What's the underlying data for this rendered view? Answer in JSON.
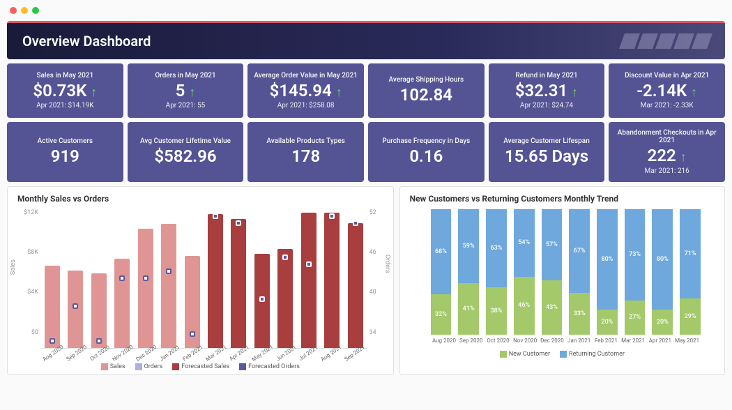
{
  "mac_dots": [
    "#ff5f57",
    "#febc2e",
    "#28c840"
  ],
  "header_title": "Overview Dashboard",
  "kpis_row1": [
    {
      "title": "Sales in May 2021",
      "value": "$0.73K",
      "arrow": true,
      "sub": "Apr 2021: $14.19K"
    },
    {
      "title": "Orders in May 2021",
      "value": "5",
      "arrow": true,
      "sub": "Apr 2021: 55"
    },
    {
      "title": "Average Order Value in May 2021",
      "value": "$145.94",
      "arrow": true,
      "sub": "Apr 2021: $258.08"
    },
    {
      "title": "Average Shipping Hours",
      "value": "102.84",
      "arrow": false,
      "sub": ""
    },
    {
      "title": "Refund in May 2021",
      "value": "$32.31",
      "arrow": true,
      "sub": "Apr 2021: $24.74"
    },
    {
      "title": "Discount Value in Apr 2021",
      "value": "-2.14K",
      "arrow": true,
      "sub": "Mar 2021: -2.33K"
    }
  ],
  "kpis_row2": [
    {
      "title": "Active Customers",
      "value": "919",
      "arrow": false,
      "sub": ""
    },
    {
      "title": "Avg Customer Lifetime Value",
      "value": "$582.96",
      "arrow": false,
      "sub": ""
    },
    {
      "title": "Available Products Types",
      "value": "178",
      "arrow": false,
      "sub": ""
    },
    {
      "title": "Purchase Frequency in Days",
      "value": "0.16",
      "arrow": false,
      "sub": ""
    },
    {
      "title": "Average Customer Lifespan",
      "value": "15.65 Days",
      "arrow": false,
      "sub": ""
    },
    {
      "title": "Abandonment Checkouts in Apr 2021",
      "value": "222",
      "arrow": true,
      "sub": "Mar 2021: 216"
    }
  ],
  "chart1_title": "Monthly Sales vs Orders",
  "chart1_ylabel": "Sales",
  "chart1_ylabel2": "Orders",
  "chart1_yticks": [
    "$12K",
    "$8K",
    "$4K",
    "$0"
  ],
  "chart1_yticks2": [
    "52",
    "46",
    "40",
    "34"
  ],
  "chart1_legend": [
    "Sales",
    "Orders",
    "Forecasted Sales",
    "Forecasted Orders"
  ],
  "chart1_legend_colors": [
    "#e09595",
    "#aab0e0",
    "#a83e3e",
    "#5a5aa0"
  ],
  "chart2_title": "New Customers vs Returning Customers Monthly Trend",
  "chart2_legend": [
    "New Customer",
    "Returning Customer"
  ],
  "chart2_legend_colors": [
    "#a4c96a",
    "#6fa8dc"
  ],
  "chart_data": [
    {
      "type": "bar",
      "title": "Monthly Sales vs Orders",
      "categories": [
        "Aug 2020",
        "Sep 2020",
        "Oct 2020",
        "Nov 2020",
        "Dec 2020",
        "Jan 2021",
        "Feb 2021",
        "Mar 2021",
        "Apr 2021",
        "May 2021",
        "Jun 2021",
        "Jul 2021",
        "Aug 2021",
        "Sep 2021"
      ],
      "series": [
        {
          "name": "Sales",
          "type": "bar",
          "color": "#e09595",
          "values": [
            8.3,
            7.8,
            7.5,
            9.0,
            12.0,
            12.5,
            9.3,
            null,
            null,
            null,
            null,
            null,
            null,
            null
          ],
          "axis": "left"
        },
        {
          "name": "Forecasted Sales",
          "type": "bar",
          "color": "#a83e3e",
          "values": [
            null,
            null,
            null,
            null,
            null,
            null,
            null,
            13.5,
            13.0,
            9.5,
            10.0,
            13.6,
            13.6,
            12.6
          ],
          "axis": "left"
        },
        {
          "name": "Orders",
          "type": "marker",
          "color": "#aab0e0",
          "values": [
            35,
            40,
            35,
            44,
            44,
            45,
            36,
            null,
            null,
            null,
            null,
            null,
            null,
            null
          ],
          "axis": "right"
        },
        {
          "name": "Forecasted Orders",
          "type": "marker",
          "color": "#5a5aa0",
          "values": [
            null,
            null,
            null,
            null,
            null,
            null,
            null,
            53,
            52,
            41,
            47,
            46,
            53,
            52
          ],
          "axis": "right"
        }
      ],
      "ylabel": "Sales",
      "ylim": [
        0,
        14
      ],
      "ylabel2": "Orders",
      "ylim2": [
        34,
        54
      ]
    },
    {
      "type": "bar-stacked-100",
      "title": "New Customers vs Returning Customers Monthly Trend",
      "categories": [
        "Aug 2020",
        "Sep 2020",
        "Oct 2020",
        "Nov 2020",
        "Dec 2020",
        "Jan 2021",
        "Feb 2021",
        "Mar 2021",
        "Apr 2021",
        "May 2021"
      ],
      "series": [
        {
          "name": "New Customer",
          "color": "#a4c96a",
          "values": [
            32,
            41,
            38,
            46,
            43,
            33,
            20,
            27,
            20,
            29
          ]
        },
        {
          "name": "Returning Customer",
          "color": "#6fa8dc",
          "values": [
            68,
            59,
            63,
            54,
            57,
            67,
            80,
            73,
            80,
            71
          ]
        }
      ]
    }
  ]
}
